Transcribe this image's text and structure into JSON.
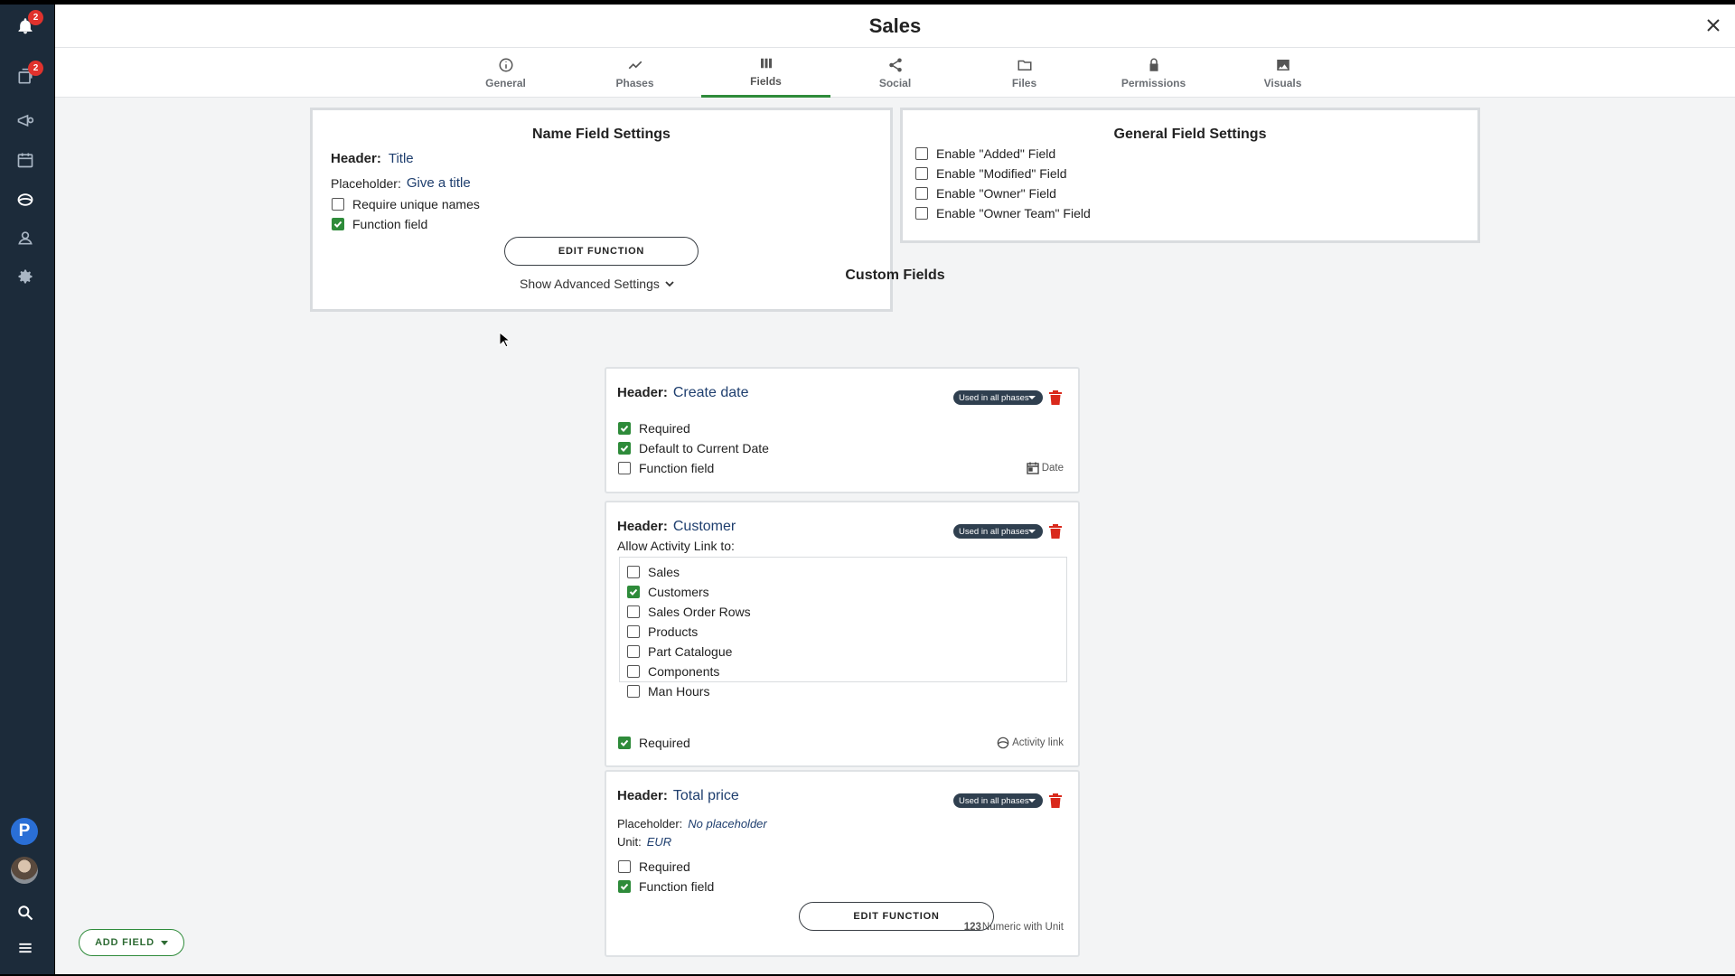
{
  "app": {
    "title": "Sales",
    "close_icon": "close-icon"
  },
  "sidebar": {
    "badges": {
      "notifications": "2",
      "updates": "2"
    },
    "user_initial": "P"
  },
  "tabs": [
    {
      "label": "General",
      "icon": "info-icon"
    },
    {
      "label": "Phases",
      "icon": "trend-icon"
    },
    {
      "label": "Fields",
      "icon": "columns-icon",
      "active": true
    },
    {
      "label": "Social",
      "icon": "share-icon"
    },
    {
      "label": "Files",
      "icon": "folder-icon"
    },
    {
      "label": "Permissions",
      "icon": "lock-icon"
    },
    {
      "label": "Visuals",
      "icon": "image-icon"
    }
  ],
  "name_field_settings": {
    "title": "Name Field Settings",
    "header_label": "Header:",
    "header_value": "Title",
    "placeholder_label": "Placeholder:",
    "placeholder_value": "Give a title",
    "require_unique": {
      "label": "Require unique names",
      "checked": false
    },
    "function_field": {
      "label": "Function field",
      "checked": true
    },
    "edit_function": "EDIT FUNCTION",
    "advanced": "Show Advanced Settings"
  },
  "general_field_settings": {
    "title": "General Field Settings",
    "options": [
      {
        "label": "Enable \"Added\" Field",
        "checked": false
      },
      {
        "label": "Enable \"Modified\" Field",
        "checked": false
      },
      {
        "label": "Enable \"Owner\" Field",
        "checked": false
      },
      {
        "label": "Enable \"Owner Team\" Field",
        "checked": false
      }
    ]
  },
  "custom_fields": {
    "title": "Custom Fields",
    "header_label": "Header:",
    "phase_label": "Used in all phases",
    "create_date": {
      "header": "Create date",
      "required": {
        "label": "Required",
        "checked": true
      },
      "default_current": {
        "label": "Default to Current Date",
        "checked": true
      },
      "function_field": {
        "label": "Function field",
        "checked": false
      },
      "type": "Date"
    },
    "customer": {
      "header": "Customer",
      "allow_label": "Allow Activity Link to:",
      "links": [
        {
          "label": "Sales",
          "checked": false
        },
        {
          "label": "Customers",
          "checked": true
        },
        {
          "label": "Sales Order Rows",
          "checked": false
        },
        {
          "label": "Products",
          "checked": false
        },
        {
          "label": "Part Catalogue",
          "checked": false
        },
        {
          "label": "Components",
          "checked": false
        },
        {
          "label": "Man Hours",
          "checked": false
        }
      ],
      "required": {
        "label": "Required",
        "checked": true
      },
      "type": "Activity link"
    },
    "total_price": {
      "header": "Total price",
      "placeholder_label": "Placeholder:",
      "placeholder_value": "No placeholder",
      "unit_label": "Unit:",
      "unit_value": "EUR",
      "required": {
        "label": "Required",
        "checked": false
      },
      "function_field": {
        "label": "Function field",
        "checked": true
      },
      "edit_function": "EDIT FUNCTION",
      "type_prefix": "123",
      "type": "Numeric with Unit"
    }
  },
  "add_field": "ADD FIELD",
  "colors": {
    "accent": "#2e8b3a",
    "sidebar": "#1c2b3a",
    "delete": "#d9291c",
    "pill": "#2f3f4f"
  }
}
